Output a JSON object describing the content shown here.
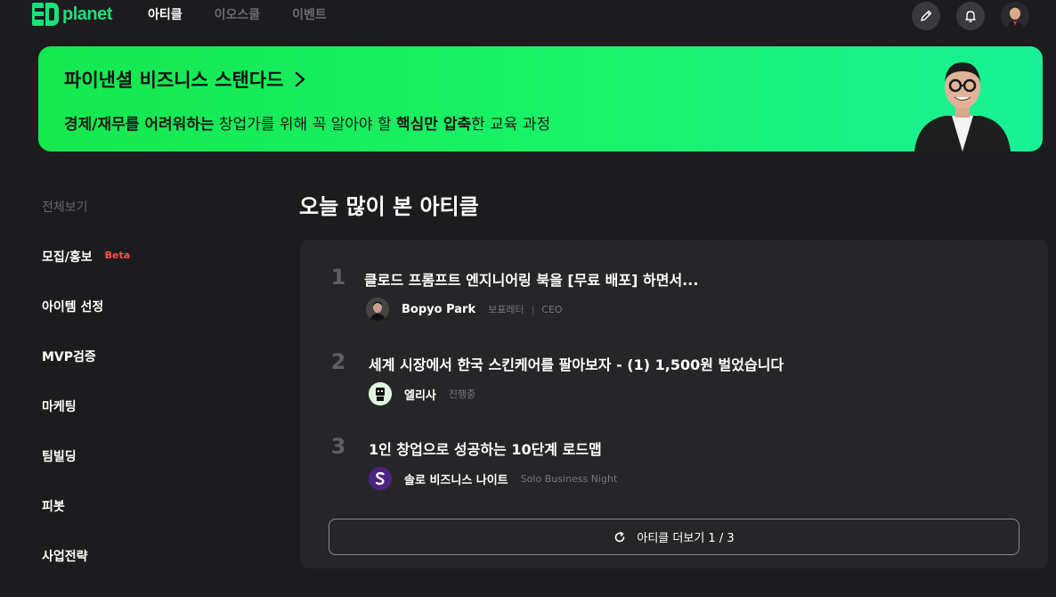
{
  "brand": {
    "name": "planet"
  },
  "nav": {
    "items": [
      {
        "label": "아티클",
        "active": true
      },
      {
        "label": "이오스쿨",
        "active": false
      },
      {
        "label": "이벤트",
        "active": false
      }
    ]
  },
  "top_actions": {
    "icons": [
      "pencil-icon",
      "bell-icon",
      "user-avatar"
    ]
  },
  "banner": {
    "title": "파이낸셜 비즈니스 스탠다드",
    "sub_part1": "경제/재무를 어려워하는",
    "sub_part2": " 창업가를 위해 꼭 알아야 할 ",
    "sub_part3": "핵심만 압축",
    "sub_part4": "한 교육 과정",
    "color_start": "#14e84e",
    "color_end": "#18f197"
  },
  "sidebar": {
    "items": [
      {
        "label": "전체보기",
        "muted": true
      },
      {
        "label": "모집/홍보",
        "badge": "Beta"
      },
      {
        "label": "아이템 선정"
      },
      {
        "label": "MVP검증"
      },
      {
        "label": "마케팅"
      },
      {
        "label": "팀빌딩"
      },
      {
        "label": "피봇"
      },
      {
        "label": "사업전략"
      }
    ]
  },
  "main": {
    "section_title": "오늘 많이 본 아티클",
    "articles": [
      {
        "rank": "1",
        "title": "클로드 프롬프트 엔지니어링 북을 [무료 배포] 하면서...",
        "author": "Bopyo Park",
        "meta1": "보표레터",
        "sep": "|",
        "meta2": "CEO"
      },
      {
        "rank": "2",
        "title": "세계 시장에서 한국 스킨케어를 팔아보자 - (1) 1,500원 벌었습니다",
        "author": "엘리사",
        "meta1": "진행중"
      },
      {
        "rank": "3",
        "title": "1인 창업으로 성공하는 10단계 로드맵",
        "author": "솔로 비즈니스 나이트",
        "meta1": "Solo Business Night"
      }
    ],
    "more_button": "아티클 더보기 1 / 3"
  },
  "colors": {
    "background": "#1c1c1e",
    "card": "#262629",
    "accent_green": "#18e27a",
    "beta_red": "#ff4d4d"
  }
}
